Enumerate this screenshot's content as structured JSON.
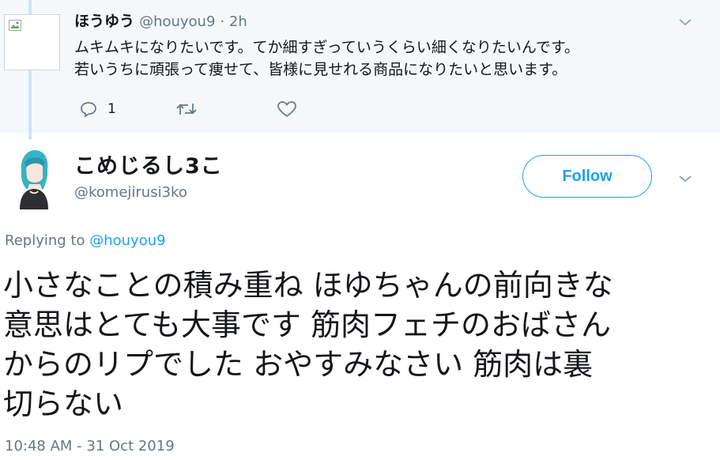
{
  "parent_tweet": {
    "display_name": "ほうゆう",
    "handle": "@houyou9",
    "time": "· 2h",
    "text_lines": [
      "ムキムキになりたいです。てか細すぎっていうくらい細くなりたいんです。",
      "若いうちに頑張って痩せて、皆様に見せれる商品になりたいと思います。"
    ],
    "reply_count": "1"
  },
  "tweet": {
    "display_name": "こめじるし3こ",
    "handle": "@komejirusi3ko",
    "follow_label": "Follow",
    "replying_prefix": "Replying to",
    "replying_handle": "@houyou9",
    "text_lines": [
      "小さなことの積み重ね ほゆちゃんの前向きな",
      "意思はとても大事です 筋肉フェチのおばさん",
      "からのリプでした おやすみなさい 筋肉は裏",
      "切らない"
    ],
    "timestamp": "10:48 AM - 31 Oct 2019"
  },
  "colors": {
    "accent": "#1da1f2",
    "secondary_text": "#657786",
    "parent_background": "#f5f8fa",
    "thread_line": "#c8e6f3"
  },
  "icons": [
    "broken-image-icon",
    "chevron-down-icon",
    "reply-icon",
    "retweet-icon",
    "like-icon"
  ]
}
